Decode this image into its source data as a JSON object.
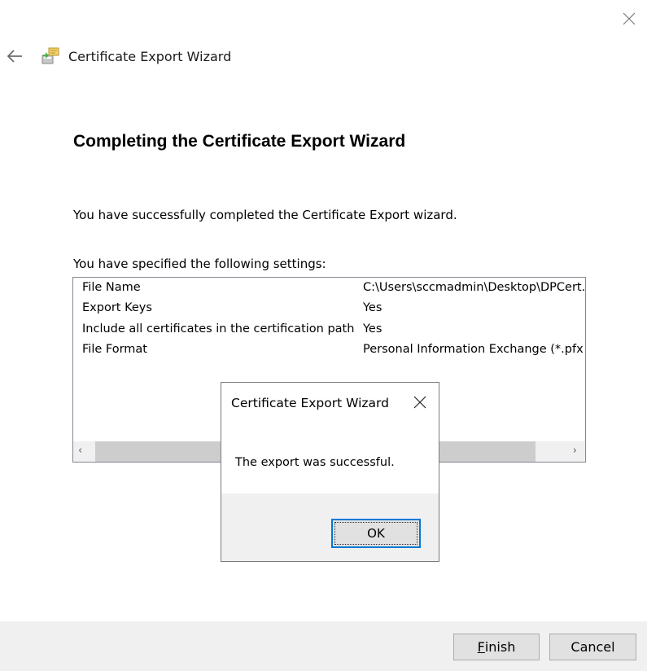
{
  "window": {
    "title": "Certificate Export Wizard"
  },
  "page": {
    "heading": "Completing the Certificate Export Wizard",
    "success_text": "You have successfully completed the Certificate Export wizard.",
    "settings_intro": "You have specified the following settings:",
    "settings": [
      {
        "key": "File Name",
        "value": "C:\\Users\\sccmadmin\\Desktop\\DPCert.pfx"
      },
      {
        "key": "Export Keys",
        "value": "Yes"
      },
      {
        "key": "Include all certificates in the certification path",
        "value": "Yes"
      },
      {
        "key": "File Format",
        "value": "Personal Information Exchange (*.pfx)"
      }
    ],
    "scroll_left": "‹",
    "scroll_right": "›"
  },
  "dialog": {
    "title": "Certificate Export Wizard",
    "message": "The export was successful.",
    "ok_label": "OK"
  },
  "footer": {
    "finish_mnemonic": "F",
    "finish_rest": "inish",
    "cancel_label": "Cancel"
  },
  "icons": {
    "window_close": "close-icon",
    "back": "back-arrow-icon",
    "wizard": "certificate-wizard-icon",
    "dialog_close": "close-icon"
  },
  "colors": {
    "accent": "#0078d7",
    "footer_bg": "#f0f0f0",
    "button_bg": "#e1e1e1"
  }
}
